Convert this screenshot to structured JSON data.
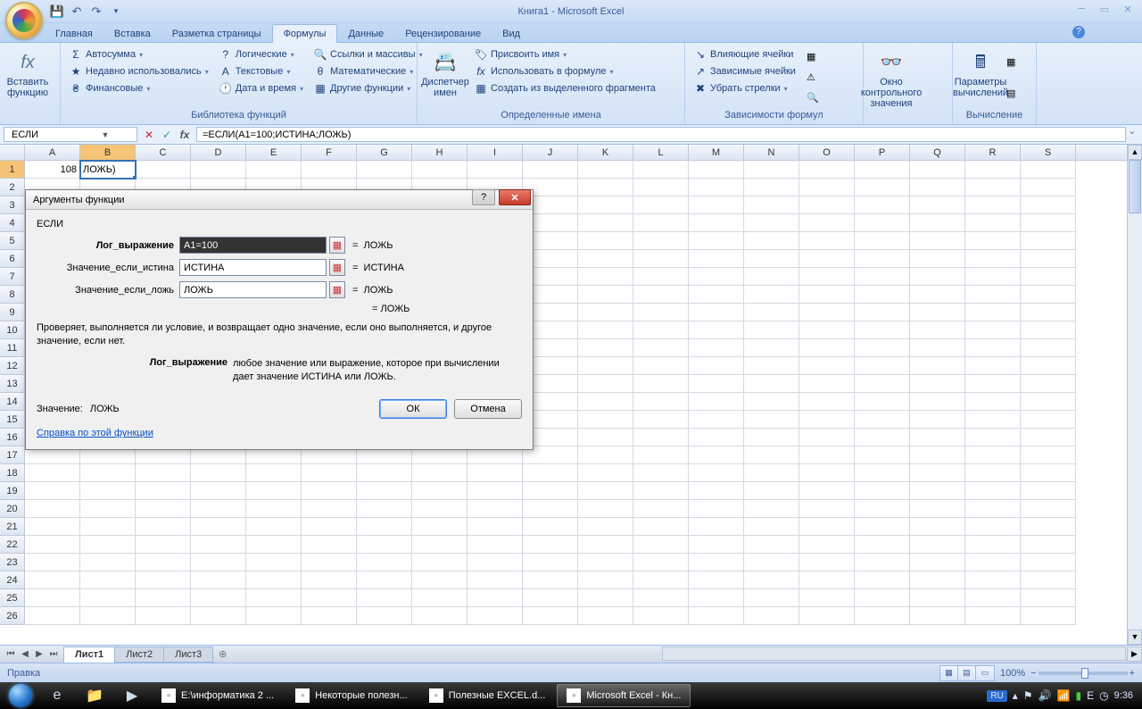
{
  "app": {
    "title": "Книга1 - Microsoft Excel"
  },
  "tabs": [
    "Главная",
    "Вставка",
    "Разметка страницы",
    "Формулы",
    "Данные",
    "Рецензирование",
    "Вид"
  ],
  "active_tab": 3,
  "ribbon": {
    "insert_fn_label": "Вставить функцию",
    "autosum": "Автосумма",
    "recent": "Недавно использовались",
    "financial": "Финансовые",
    "logical": "Логические",
    "text": "Текстовые",
    "datetime": "Дата и время",
    "lookup": "Ссылки и массивы",
    "math": "Математические",
    "more": "Другие функции",
    "lib_label": "Библиотека функций",
    "name_mgr": "Диспетчер имен",
    "assign": "Присвоить имя",
    "use_in": "Использовать в формуле",
    "from_sel": "Создать из выделенного фрагмента",
    "names_label": "Определенные имена",
    "trace_prec": "Влияющие ячейки",
    "trace_dep": "Зависимые ячейки",
    "remove_arr": "Убрать стрелки",
    "deps_label": "Зависимости формул",
    "watch": "Окно контрольного значения",
    "calc_opts": "Параметры вычислений",
    "calc_label": "Вычисление"
  },
  "fbar": {
    "name": "ЕСЛИ",
    "formula": "=ЕСЛИ(A1=100;ИСТИНА;ЛОЖЬ)"
  },
  "cols": [
    "A",
    "B",
    "C",
    "D",
    "E",
    "F",
    "G",
    "H",
    "I",
    "J",
    "K",
    "L",
    "M",
    "N",
    "O",
    "P",
    "Q",
    "R",
    "S"
  ],
  "active_col": "B",
  "active_row": 1,
  "cells": {
    "A1": "108",
    "B1": "ЛОЖЬ)"
  },
  "dialog": {
    "title": "Аргументы функции",
    "fn": "ЕСЛИ",
    "args": [
      {
        "label": "Лог_выражение",
        "value": "A1=100",
        "result": "ЛОЖЬ",
        "bold": true,
        "hi": true
      },
      {
        "label": "Значение_если_истина",
        "value": "ИСТИНА",
        "result": "ИСТИНА",
        "bold": false
      },
      {
        "label": "Значение_если_ложь",
        "value": "ЛОЖЬ",
        "result": "ЛОЖЬ",
        "bold": false
      }
    ],
    "overall_result": "ЛОЖЬ",
    "description": "Проверяет, выполняется ли условие, и возвращает одно значение, если оно выполняется, и другое значение, если нет.",
    "arg_name": "Лог_выражение",
    "arg_desc": "любое значение или выражение, которое при вычислении дает значение ИСТИНА или ЛОЖЬ.",
    "value_label": "Значение:",
    "value": "ЛОЖЬ",
    "help": "Справка по этой функции",
    "ok": "ОК",
    "cancel": "Отмена"
  },
  "sheets": [
    "Лист1",
    "Лист2",
    "Лист3"
  ],
  "active_sheet": 0,
  "status": {
    "mode": "Правка",
    "zoom": "100%"
  },
  "taskbar": {
    "items": [
      {
        "label": "E:\\информатика 2 ..."
      },
      {
        "label": "Некоторые полезн..."
      },
      {
        "label": "Полезные EXCEL.d..."
      },
      {
        "label": "Microsoft Excel - Кн...",
        "active": true
      }
    ],
    "lang": "RU",
    "time": "9:36"
  }
}
